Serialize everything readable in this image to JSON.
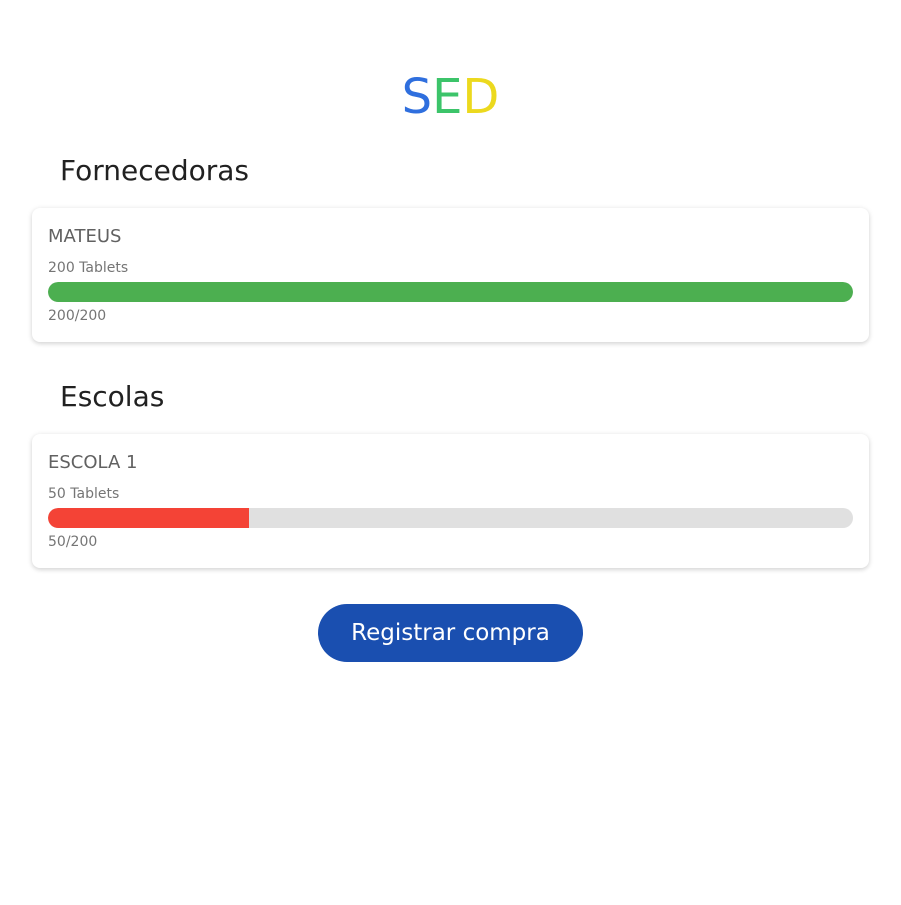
{
  "logo": {
    "letters": [
      "S",
      "E",
      "D"
    ],
    "colors": [
      "#2f6fde",
      "#3cc46a",
      "#ecd91e"
    ]
  },
  "fornecedoras": {
    "title": "Fornecedoras",
    "items": [
      {
        "name": "MATEUS",
        "subtitle": "200 Tablets",
        "count_label": "200/200",
        "progress": 1.0,
        "bar_color": "#4caf50"
      }
    ]
  },
  "escolas": {
    "title": "Escolas",
    "items": [
      {
        "name": "ESCOLA 1",
        "subtitle": "50 Tablets",
        "count_label": "50/200",
        "progress": 0.25,
        "bar_color": "#f44336"
      }
    ]
  },
  "actions": {
    "register_label": "Registrar compra",
    "register_color": "#1a4fb0"
  }
}
